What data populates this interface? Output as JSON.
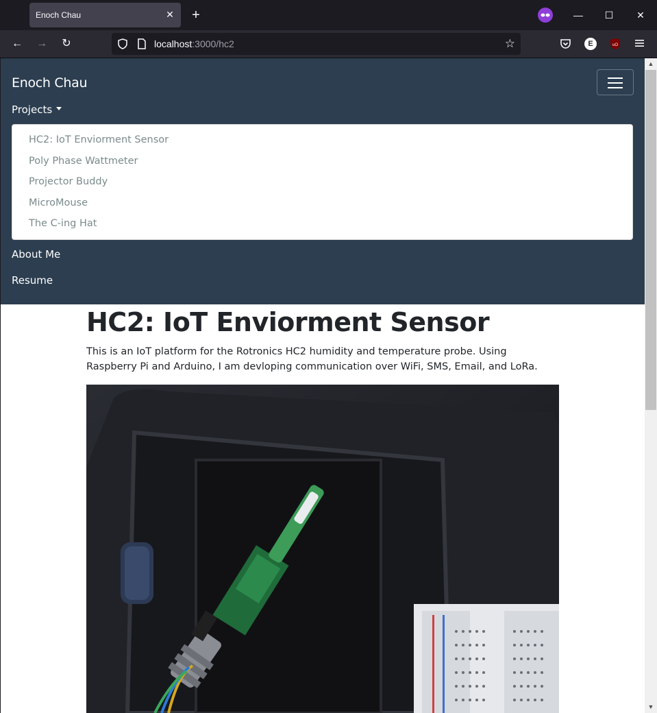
{
  "browser": {
    "tab_title": "Enoch Chau",
    "url_host": "localhost",
    "url_path": ":3000/hc2",
    "colors": {
      "chrome_bg": "#1c1b22",
      "tab_active": "#42414d",
      "toolbar": "#2b2a33",
      "private_accent": "#8f3fd8",
      "ublock_red": "#800000"
    },
    "icons": [
      "back-arrow-icon",
      "forward-arrow-icon",
      "reload-icon",
      "shield-icon",
      "page-icon",
      "star-icon",
      "pocket-icon",
      "extension-e-icon",
      "ublock-icon",
      "menu-icon",
      "private-mask-icon",
      "minimize-icon",
      "maximize-icon",
      "close-window-icon"
    ]
  },
  "site": {
    "brand": "Enoch Chau",
    "nav": {
      "projects_label": "Projects",
      "about_label": "About Me",
      "resume_label": "Resume"
    },
    "dropdown": [
      "HC2: IoT Enviorment Sensor",
      "Poly Phase Wattmeter",
      "Projector Buddy",
      "MicroMouse",
      "The C-ing Hat"
    ],
    "colors": {
      "navbar_bg": "#2c3e50",
      "dropdown_text": "#7b8a8b",
      "body_text": "#212529"
    }
  },
  "page": {
    "title": "HC2: IoT Enviorment Sensor",
    "description": "This is an IoT platform for the Rotronics HC2 humidity and temperature probe. Using Raspberry Pi and Arduino, I am devloping communication over WiFi, SMS, Email, and LoRa."
  }
}
